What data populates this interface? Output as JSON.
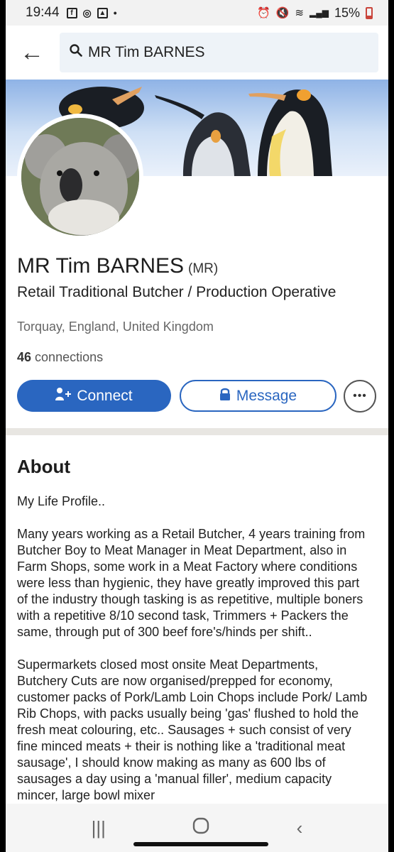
{
  "status_bar": {
    "time": "19:44",
    "battery": "15%"
  },
  "search": {
    "query": "MR Tim BARNES"
  },
  "profile": {
    "name": "MR Tim BARNES",
    "pronoun": "(MR)",
    "headline": "Retail Traditional Butcher / Production Operative",
    "location": "Torquay, England, United Kingdom",
    "connections_count": "46",
    "connections_label": "connections"
  },
  "actions": {
    "connect_label": "Connect",
    "message_label": "Message"
  },
  "about": {
    "title": "About",
    "paragraphs": [
      "My Life Profile..",
      "Many years working as a Retail Butcher, 4 years training from Butcher Boy to Meat Manager in Meat Department, also in Farm Shops, some work in a Meat Factory where conditions were less than hygienic, they have greatly improved this part of the industry though tasking is as repetitive, multiple boners with a repetitive 8/10 second task, Trimmers + Packers the same, through put of 300 beef fore's/hinds per shift..",
      "Supermarkets closed most onsite Meat Departments, Butchery Cuts are now organised/prepped for economy, customer packs of Pork/Lamb Loin Chops include Pork/ Lamb Rib Chops, with packs usually being 'gas' flushed to hold the fresh meat colouring, etc.. Sausages + such consist of very fine minced meats + their is nothing like a 'traditional meat sausage', I should know making as many as 600 lbs of sausages a day using a 'manual filler', medium capacity mincer, large bowl mixer"
    ]
  },
  "colors": {
    "primary": "#2a66c0",
    "divider": "#e8e6e2"
  }
}
